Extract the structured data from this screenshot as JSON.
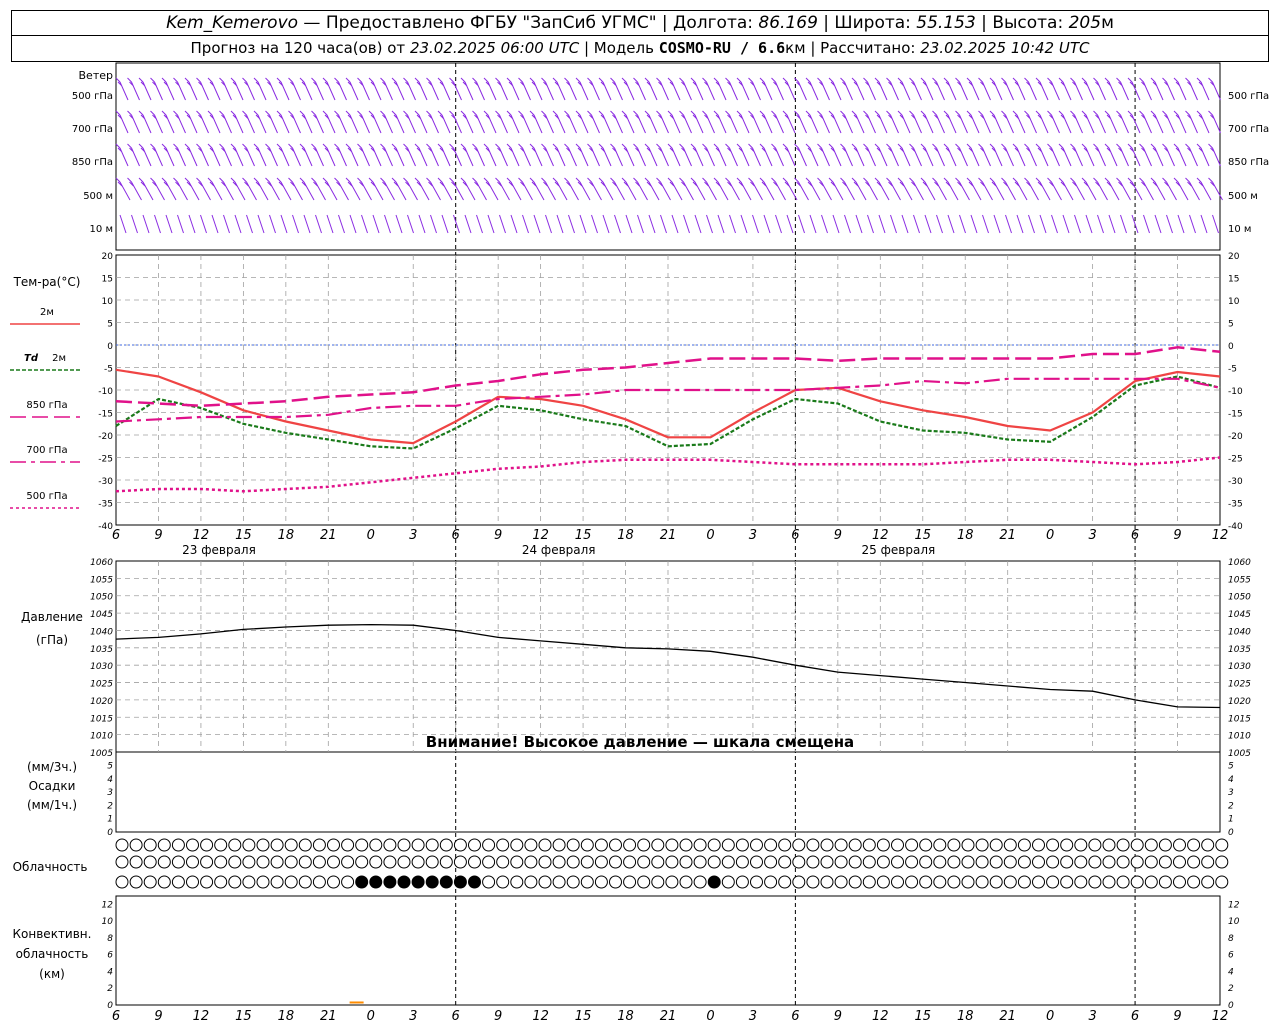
{
  "header": {
    "station": "Kem_Kemerovo",
    "provider": " — Предоставлено ФГБУ \"ЗапСиб УГМС\" | Долгота: ",
    "longitude": "86.169",
    "lat_label": " | Широта: ",
    "latitude": "55.153",
    "alt_label": " | Высота: ",
    "altitude": "205",
    "alt_unit": "м",
    "forecast_label": "Прогноз на 120 часа(ов) от ",
    "forecast_start": "23.02.2025 06:00 UTC",
    "model_label": " | Модель ",
    "model": "COSMO-RU / 6.6",
    "model_unit": "км",
    "calc_label": " | Рассчитано: ",
    "calc_time": "23.02.2025 10:42 UTC"
  },
  "colors": {
    "wind": "#8a2be2",
    "t2m": "#ef4444",
    "td2m": "#1a7a1a",
    "t850": "#e0118a",
    "t700": "#e0118a",
    "t500": "#e0118a",
    "pressure": "#000000",
    "zero_line": "#4169e1",
    "grid": "#a0a0a0",
    "cb_bar": "#ff8c00"
  },
  "wind_panel": {
    "title": "Ветер",
    "levels": [
      "500 гПа",
      "700 гПа",
      "850 гПа",
      "500 м",
      "10  м"
    ]
  },
  "x_axis": {
    "ticks": [
      "6",
      "9",
      "12",
      "15",
      "18",
      "21",
      "0",
      "3",
      "6",
      "9",
      "12",
      "15",
      "18",
      "21",
      "0",
      "3",
      "6",
      "9",
      "12",
      "15",
      "18",
      "21",
      "0",
      "3",
      "6",
      "9",
      "12"
    ],
    "day_labels": [
      "23 февраля",
      "24 февраля",
      "25 февраля"
    ]
  },
  "legend": {
    "title": "Тем-ра(°С)",
    "t2m": "2м",
    "td_symbol": "Td",
    "td2m": "2м",
    "t850": "850 гПа",
    "t700": "700 гПа",
    "t500": "500 гПа"
  },
  "pressure_panel": {
    "label1": "Давление",
    "label2": "(гПа)",
    "warning": "Внимание! Высокое давление — шкала смещена"
  },
  "precip_panel": {
    "label1": "(мм/3ч.)",
    "label2": "Осадки",
    "label3": "(мм/1ч.)",
    "yticks": [
      "0",
      "1",
      "2",
      "3",
      "4",
      "5"
    ]
  },
  "cloud_panel": {
    "label": "Облачность"
  },
  "conv_panel": {
    "label1": "Конвективн.",
    "label2": "облачность",
    "label3": "(км)",
    "yticks": [
      "0",
      "2",
      "4",
      "6",
      "8",
      "10",
      "12"
    ]
  },
  "chart_data": {
    "type": "line",
    "x_hours": [
      0,
      3,
      6,
      9,
      12,
      15,
      18,
      21,
      24,
      27,
      30,
      33,
      36,
      39,
      42,
      45,
      48,
      51,
      54,
      57,
      60,
      63,
      66,
      69,
      72,
      75,
      78
    ],
    "temperature": {
      "ylim": [
        -40,
        20
      ],
      "yticks": [
        -40,
        -35,
        -30,
        -25,
        -20,
        -15,
        -10,
        -5,
        0,
        5,
        10,
        15,
        20
      ],
      "series": [
        {
          "name": "2м",
          "key": "t2m",
          "values": [
            -5.5,
            -7,
            -10.5,
            -14.5,
            -17,
            -19,
            -21,
            -21.8,
            -17,
            -11.5,
            -12,
            -13.5,
            -16.5,
            -20.5,
            -20.5,
            -15,
            -10,
            -9.5,
            -12.5,
            -14.5,
            -16,
            -18,
            -19,
            -15,
            -8,
            -6,
            -7
          ]
        },
        {
          "name": "Td 2м",
          "key": "td2m",
          "values": [
            -18,
            -12,
            -14,
            -17.5,
            -19.5,
            -21,
            -22.5,
            -23,
            -18.5,
            -13.5,
            -14.5,
            -16.5,
            -18,
            -22.5,
            -22,
            -16.5,
            -12,
            -13,
            -17,
            -19,
            -19.5,
            -21,
            -21.5,
            -16,
            -9,
            -7,
            -9.5
          ]
        },
        {
          "name": "850 гПа",
          "key": "t850",
          "values": [
            -12.5,
            -13,
            -13.5,
            -13,
            -12.5,
            -11.5,
            -11,
            -10.5,
            -9,
            -8,
            -6.5,
            -5.5,
            -5,
            -4,
            -3,
            -3,
            -3,
            -3.5,
            -3,
            -3,
            -3,
            -3,
            -3,
            -2,
            -2,
            -0.5,
            -1.5
          ]
        },
        {
          "name": "700 гПа",
          "key": "t700",
          "values": [
            -17,
            -16.5,
            -16,
            -16,
            -16,
            -15.5,
            -14,
            -13.5,
            -13.5,
            -12,
            -11.5,
            -11,
            -10,
            -10,
            -10,
            -10,
            -10,
            -9.5,
            -9,
            -8,
            -8.5,
            -7.5,
            -7.5,
            -7.5,
            -7.5,
            -7.5,
            -9.5
          ]
        },
        {
          "name": "500 гПа",
          "key": "t500",
          "values": [
            -32.5,
            -32,
            -32,
            -32.5,
            -32,
            -31.5,
            -30.5,
            -29.5,
            -28.5,
            -27.5,
            -27,
            -26,
            -25.5,
            -25.5,
            -25.5,
            -26,
            -26.5,
            -26.5,
            -26.5,
            -26.5,
            -26,
            -25.5,
            -25.5,
            -26,
            -26.5,
            -26,
            -25
          ]
        }
      ]
    },
    "pressure": {
      "ylim": [
        1005,
        1060
      ],
      "yticks": [
        1005,
        1010,
        1015,
        1020,
        1025,
        1030,
        1035,
        1040,
        1045,
        1050,
        1055,
        1060
      ],
      "values": [
        1037.5,
        1038,
        1039,
        1040.3,
        1041,
        1041.5,
        1041.7,
        1041.5,
        1040,
        1038,
        1037,
        1036,
        1035,
        1034.7,
        1034,
        1032.3,
        1030,
        1028,
        1027,
        1026,
        1025,
        1024,
        1023,
        1022.5,
        1020,
        1018,
        1017.8
      ]
    },
    "precipitation": {
      "ylim": [
        0,
        5
      ],
      "values": []
    },
    "convective_cloud_top_km": {
      "ylim": [
        0,
        13
      ],
      "bars": [
        {
          "x_hour": 17,
          "value": 0.3
        }
      ]
    }
  }
}
